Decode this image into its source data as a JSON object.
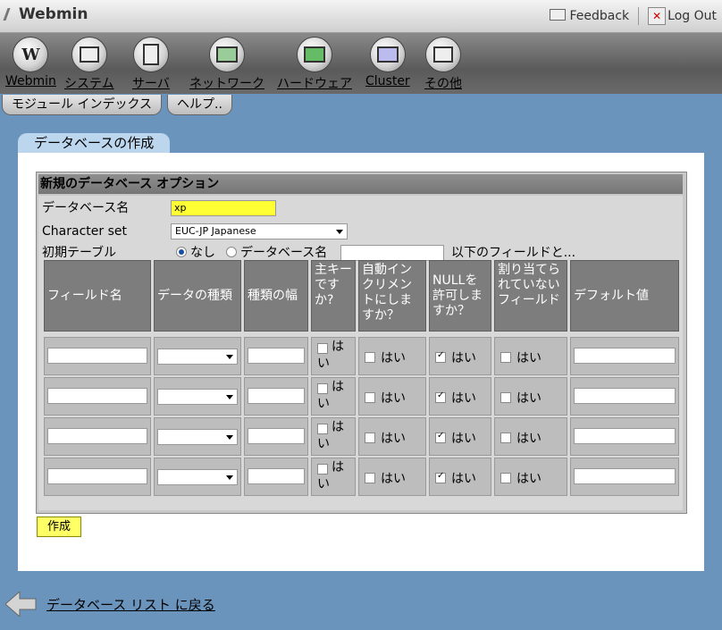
{
  "header": {
    "brand": "Webmin",
    "feedback": "Feedback",
    "logout": "Log Out"
  },
  "categories": [
    {
      "label": "Webmin",
      "icon": "webmin-icon"
    },
    {
      "label": "システム",
      "icon": "computer-icon"
    },
    {
      "label": "サーバ",
      "icon": "server-icon"
    },
    {
      "label": "ネットワーク",
      "icon": "network-icon"
    },
    {
      "label": "ハードウェア",
      "icon": "hardware-icon"
    },
    {
      "label": "Cluster",
      "icon": "cluster-icon"
    },
    {
      "label": "その他",
      "icon": "others-icon"
    }
  ],
  "module_tabs": [
    "モジュール インデックス",
    "ヘルプ.."
  ],
  "page_title": "データベースの作成",
  "form": {
    "heading": "新規のデータベース オプション",
    "db_name_label": "データベース名",
    "db_name_value": "xp",
    "charset_label": "Character set",
    "charset_value": "EUC-JP Japanese",
    "initial_table_label": "初期テーブル",
    "radio_none": "なし",
    "radio_db": "データベース名",
    "radio_db_suffix": "以下のフィールドと..."
  },
  "table": {
    "headers": [
      "フィールド名",
      "データの種類",
      "種類の幅",
      "主キーですか?",
      "自動インクリメントにしますか？",
      "NULLを許可しますか？",
      "割り当てられていないフィールド",
      "デフォルト値"
    ],
    "yes": "はい",
    "rows": [
      {
        "null_checked": true
      },
      {
        "null_checked": true
      },
      {
        "null_checked": true
      },
      {
        "null_checked": true
      }
    ]
  },
  "submit_label": "作成",
  "back_link": "データベース リスト に戻る"
}
